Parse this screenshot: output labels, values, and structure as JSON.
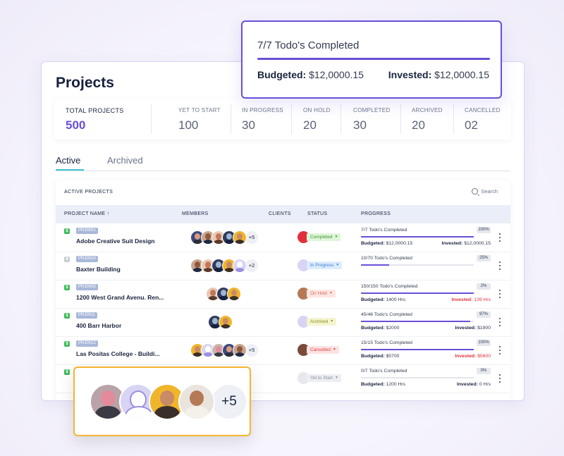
{
  "page": {
    "title": "Projects"
  },
  "stats": [
    {
      "label": "TOTAL PROJECTS",
      "value": "500"
    },
    {
      "label": "YET TO START",
      "value": "100"
    },
    {
      "label": "IN PROGRESS",
      "value": "30"
    },
    {
      "label": "ON HOLD",
      "value": "20"
    },
    {
      "label": "COMPLETED",
      "value": "30"
    },
    {
      "label": "ARCHIVED",
      "value": "20"
    },
    {
      "label": "CANCELLED",
      "value": "02"
    }
  ],
  "tabs": [
    {
      "label": "Active"
    },
    {
      "label": "Archived"
    }
  ],
  "table": {
    "title": "ACTIVE PROJECTS",
    "search_label": "Search",
    "columns": {
      "name": "PROJECT NAME ↑",
      "members": "MEMBERS",
      "clients": "CLIENTS",
      "status": "STATUS",
      "progress": "PROGRESS"
    },
    "rows": [
      {
        "billable": true,
        "id": "PRJ0001",
        "name": "Adobe Creative Suit Design",
        "member_count": 5,
        "more": "+5",
        "status": "Completed",
        "status_color": "#dff5d8",
        "status_text_color": "#3a9a2e",
        "progress_text": "7/7 Todo's Completed",
        "percent_label": "100%",
        "progress": 1.0,
        "budget_label": "Budgeted:",
        "budget": "$12,0000.15",
        "invest_label": "Invested:",
        "invested": "$12,0000.15",
        "over": false
      },
      {
        "billable": false,
        "id": "PRJ0010",
        "name": "Baxter Building",
        "member_count": 5,
        "more": "+2",
        "status": "In Progress",
        "status_color": "#dcecfb",
        "status_text_color": "#3d7ed6",
        "progress_text": "10/70 Todo's Completed",
        "percent_label": "25%",
        "progress": 0.25,
        "budget_label": "",
        "budget": "",
        "invest_label": "",
        "invested": "",
        "over": false
      },
      {
        "billable": true,
        "id": "PRJ0005",
        "name": "1200 West Grand Avenu. Ren...",
        "member_count": 3,
        "more": "",
        "status": "On Hold",
        "status_color": "#fde5e2",
        "status_text_color": "#e06a5b",
        "progress_text": "150/150 Todo's Completed",
        "percent_label": "2%",
        "progress": 1.0,
        "budget_label": "Budgeted:",
        "budget": "1400 Hrs",
        "invest_label": "Invested:",
        "invested": "139 Hrs",
        "over": true
      },
      {
        "billable": true,
        "id": "PRJ0011",
        "name": "400 Barr Harbor",
        "member_count": 2,
        "more": "",
        "status": "Archived",
        "status_color": "#f4f5cf",
        "status_text_color": "#8a8c1e",
        "progress_text": "45/46 Todo's Completed",
        "percent_label": "97%",
        "progress": 0.97,
        "budget_label": "Budgeted:",
        "budget": "$2000",
        "invest_label": "Invested:",
        "invested": "$1900",
        "over": false
      },
      {
        "billable": true,
        "id": "PRJ0012",
        "name": "Las Positas College - Buildi...",
        "member_count": 5,
        "more": "+5",
        "status": "Cancelled",
        "status_color": "#fde2e2",
        "status_text_color": "#e0413c",
        "progress_text": "15/15 Todo's Completed",
        "percent_label": "100%",
        "progress": 1.0,
        "budget_label": "Budgeted:",
        "budget": "$5700",
        "invest_label": "Invested:",
        "invested": "$5600",
        "over": true
      },
      {
        "billable": true,
        "id": "",
        "name": "",
        "member_count": 0,
        "more": "",
        "status": "Yet to Start",
        "status_color": "#eceef2",
        "status_text_color": "#8a8f9c",
        "progress_text": "0/7 Todo's Completed",
        "percent_label": "0%",
        "progress": 0.0,
        "budget_label": "Budgeted:",
        "budget": "1200 Hrs",
        "invest_label": "Invested:",
        "invested": "0 Hrs",
        "over": false
      }
    ]
  },
  "callout_progress": {
    "title": "7/7 Todo's Completed",
    "progress": 1.0,
    "budget_label": "Budgeted:",
    "budget": "$12,0000.15",
    "invest_label": "Invested:",
    "invested": "$12,0000.15"
  },
  "callout_members": {
    "more": "+5"
  },
  "colors": {
    "accent": "#6a4fd8",
    "tab_underline": "#3cc3d4",
    "callout_top_border": "#6a4fd8",
    "callout_bottom_border": "#f5b431"
  }
}
